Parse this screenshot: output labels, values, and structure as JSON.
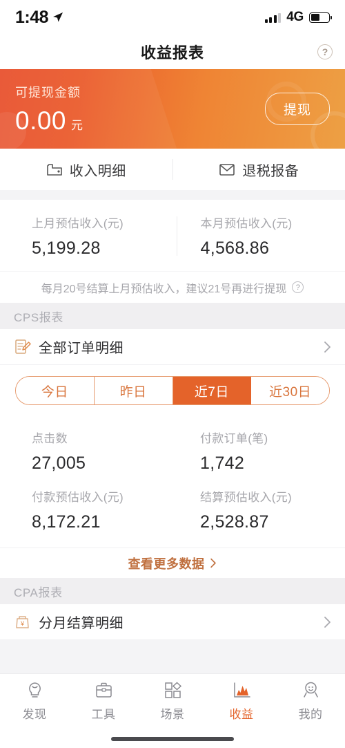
{
  "status_bar": {
    "time": "1:48",
    "network": "4G",
    "location_icon": "location-arrow-icon",
    "signal_icon": "signal-bars-icon",
    "battery_icon": "battery-icon"
  },
  "header": {
    "title": "收益报表",
    "help_icon": "question-circle-icon",
    "help_label": "?"
  },
  "banner": {
    "label": "可提现金额",
    "amount": "0.00",
    "unit": "元",
    "withdraw_button": "提现",
    "gradient_start": "#e8512e",
    "gradient_end": "#eda044"
  },
  "quick_links": [
    {
      "label": "收入明细",
      "icon": "wallet-icon"
    },
    {
      "label": "退税报备",
      "icon": "envelope-icon"
    }
  ],
  "estimates": [
    {
      "label": "上月预估收入(元)",
      "value": "5,199.28"
    },
    {
      "label": "本月预估收入(元)",
      "value": "4,568.86"
    }
  ],
  "note": {
    "text": "每月20号结算上月预估收入，建议21号再进行提现",
    "help_icon": "question-circle-icon",
    "help_label": "?"
  },
  "cps_section": {
    "title": "CPS报表",
    "order_row": {
      "label": "全部订单明细",
      "icon": "document-pen-icon",
      "chevron": "chevron-right-icon"
    },
    "tabs": [
      {
        "label": "今日",
        "active": false
      },
      {
        "label": "昨日",
        "active": false
      },
      {
        "label": "近7日",
        "active": true
      },
      {
        "label": "近30日",
        "active": false
      }
    ],
    "stats": [
      {
        "label": "点击数",
        "value": "27,005"
      },
      {
        "label": "付款订单(笔)",
        "value": "1,742"
      },
      {
        "label": "付款预估收入(元)",
        "value": "8,172.21"
      },
      {
        "label": "结算预估收入(元)",
        "value": "2,528.87"
      }
    ],
    "more_label": "查看更多数据",
    "more_chevron": "chevron-right-icon",
    "accent_color": "#e4632a"
  },
  "cpa_section": {
    "title": "CPA报表",
    "settlement_row": {
      "label": "分月结算明细",
      "icon": "money-bag-icon",
      "chevron": "chevron-right-icon"
    }
  },
  "tab_bar": [
    {
      "label": "发现",
      "icon": "lightbulb-icon",
      "active": false
    },
    {
      "label": "工具",
      "icon": "briefcase-icon",
      "active": false
    },
    {
      "label": "场景",
      "icon": "shapes-icon",
      "active": false
    },
    {
      "label": "收益",
      "icon": "chart-icon",
      "active": true
    },
    {
      "label": "我的",
      "icon": "person-icon",
      "active": false
    }
  ]
}
